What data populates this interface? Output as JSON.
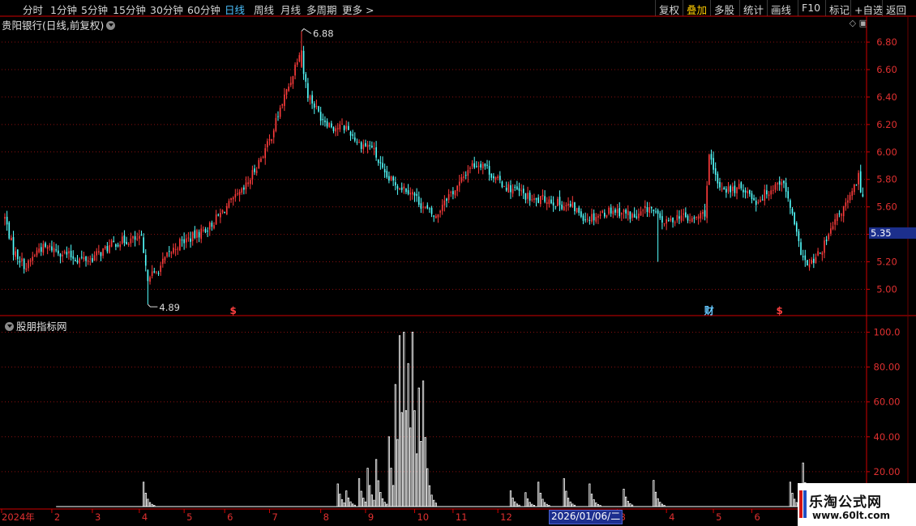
{
  "toolbar": {
    "left": [
      "分时",
      "1分钟",
      "5分钟",
      "15分钟",
      "30分钟",
      "60分钟",
      "日线",
      "周线",
      "月线",
      "多周期",
      "更多 >"
    ],
    "active_index": 6,
    "right": [
      "复权",
      "叠加",
      "多股",
      "统计",
      "画线",
      "F10",
      "标记",
      "+自选",
      "返回"
    ],
    "right_on_index": 1
  },
  "main_title": "贵阳银行(日线,前复权)",
  "indicator_title": "股朋指标网",
  "current_date": "2026/01/06/二",
  "current_price": "5.35",
  "watermark": {
    "name": "乐淘公式网",
    "url": "www.60lt.com"
  },
  "colors": {
    "up": "#ff3c3c",
    "down": "#54ffff",
    "grid": "#8a1010",
    "axis": "#d00000",
    "tick_text": "#e03030",
    "bar": "#ffffff"
  },
  "chart_data": [
    {
      "type": "candlestick",
      "ylim": [
        4.82,
        6.93
      ],
      "yticks": [
        5.0,
        5.2,
        5.4,
        5.6,
        5.8,
        6.0,
        6.2,
        6.4,
        6.6,
        6.8
      ],
      "annotations": [
        {
          "label": "6.88",
          "x": 139,
          "value": 6.88
        },
        {
          "label": "4.89",
          "x": 67,
          "value": 4.89
        }
      ],
      "markers": [
        {
          "label": "$",
          "x": 107,
          "color": "#ff4040"
        },
        {
          "label": "财",
          "x": 330,
          "color": "#66c8ff"
        },
        {
          "label": "$",
          "x": 363,
          "color": "#ff4040"
        }
      ],
      "keypoints": [
        [
          0,
          5.52
        ],
        [
          4,
          5.28
        ],
        [
          10,
          5.16
        ],
        [
          16,
          5.3
        ],
        [
          22,
          5.3
        ],
        [
          28,
          5.26
        ],
        [
          34,
          5.22
        ],
        [
          40,
          5.22
        ],
        [
          46,
          5.28
        ],
        [
          52,
          5.34
        ],
        [
          58,
          5.36
        ],
        [
          64,
          5.36
        ],
        [
          66,
          5.14
        ],
        [
          70,
          5.1
        ],
        [
          76,
          5.24
        ],
        [
          82,
          5.34
        ],
        [
          88,
          5.38
        ],
        [
          96,
          5.46
        ],
        [
          104,
          5.6
        ],
        [
          112,
          5.72
        ],
        [
          118,
          5.9
        ],
        [
          124,
          6.08
        ],
        [
          130,
          6.36
        ],
        [
          134,
          6.52
        ],
        [
          138,
          6.74
        ],
        [
          142,
          6.42
        ],
        [
          148,
          6.26
        ],
        [
          154,
          6.18
        ],
        [
          160,
          6.18
        ],
        [
          166,
          6.06
        ],
        [
          172,
          6.04
        ],
        [
          178,
          5.82
        ],
        [
          184,
          5.76
        ],
        [
          190,
          5.72
        ],
        [
          196,
          5.6
        ],
        [
          202,
          5.52
        ],
        [
          206,
          5.66
        ],
        [
          212,
          5.74
        ],
        [
          218,
          5.9
        ],
        [
          224,
          5.92
        ],
        [
          230,
          5.8
        ],
        [
          236,
          5.74
        ],
        [
          242,
          5.7
        ],
        [
          248,
          5.64
        ],
        [
          254,
          5.66
        ],
        [
          260,
          5.62
        ],
        [
          266,
          5.6
        ],
        [
          272,
          5.52
        ],
        [
          278,
          5.54
        ],
        [
          284,
          5.58
        ],
        [
          290,
          5.56
        ],
        [
          296,
          5.52
        ],
        [
          302,
          5.6
        ],
        [
          306,
          5.52
        ],
        [
          310,
          5.48
        ],
        [
          316,
          5.54
        ],
        [
          322,
          5.5
        ],
        [
          328,
          5.56
        ],
        [
          330,
          5.96
        ],
        [
          334,
          5.76
        ],
        [
          340,
          5.72
        ],
        [
          346,
          5.74
        ],
        [
          352,
          5.64
        ],
        [
          358,
          5.72
        ],
        [
          364,
          5.8
        ],
        [
          368,
          5.6
        ],
        [
          372,
          5.32
        ],
        [
          376,
          5.16
        ],
        [
          380,
          5.22
        ],
        [
          384,
          5.32
        ],
        [
          390,
          5.52
        ],
        [
          396,
          5.66
        ],
        [
          400,
          5.82
        ],
        [
          402,
          5.66
        ]
      ],
      "total_bars": 403
    },
    {
      "type": "bar",
      "ylim": [
        0,
        103
      ],
      "yticks": [
        20.0,
        40.0,
        60.0,
        80.0,
        100.0
      ],
      "spikes": [
        {
          "x": 65,
          "peak": 14
        },
        {
          "x": 156,
          "peak": 13
        },
        {
          "x": 160,
          "peak": 9
        },
        {
          "x": 166,
          "peak": 16
        },
        {
          "x": 170,
          "peak": 22
        },
        {
          "x": 174,
          "peak": 27
        },
        {
          "x": 180,
          "peak": 40
        },
        {
          "x": 183,
          "peak": 70
        },
        {
          "x": 185,
          "peak": 98
        },
        {
          "x": 187,
          "peak": 100
        },
        {
          "x": 189,
          "peak": 82
        },
        {
          "x": 191,
          "peak": 100
        },
        {
          "x": 194,
          "peak": 68
        },
        {
          "x": 196,
          "peak": 72
        },
        {
          "x": 237,
          "peak": 9
        },
        {
          "x": 244,
          "peak": 8
        },
        {
          "x": 250,
          "peak": 14
        },
        {
          "x": 262,
          "peak": 16
        },
        {
          "x": 274,
          "peak": 13
        },
        {
          "x": 290,
          "peak": 10
        },
        {
          "x": 304,
          "peak": 15
        },
        {
          "x": 368,
          "peak": 14
        },
        {
          "x": 374,
          "peak": 25
        }
      ],
      "total_bars": 403
    }
  ],
  "x_axis": {
    "labels": [
      {
        "label": "2024年",
        "x": 0
      },
      {
        "label": "2",
        "x": 22
      },
      {
        "label": "3",
        "x": 41
      },
      {
        "label": "4",
        "x": 63
      },
      {
        "label": "5",
        "x": 84
      },
      {
        "label": "6",
        "x": 103
      },
      {
        "label": "7",
        "x": 124
      },
      {
        "label": "8",
        "x": 148
      },
      {
        "label": "9",
        "x": 169
      },
      {
        "label": "10",
        "x": 192
      },
      {
        "label": "11",
        "x": 210
      },
      {
        "label": "12",
        "x": 231
      },
      {
        "label": "3",
        "x": 287
      },
      {
        "label": "4",
        "x": 310
      },
      {
        "label": "5",
        "x": 332
      },
      {
        "label": "6",
        "x": 350
      }
    ]
  }
}
